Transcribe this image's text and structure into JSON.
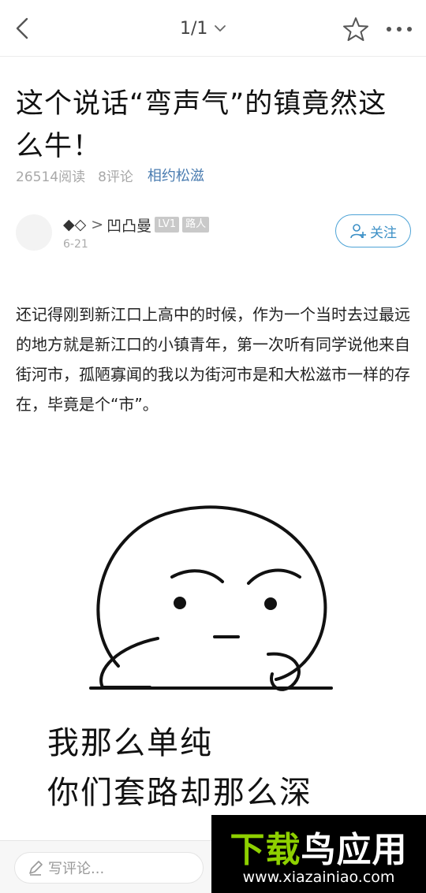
{
  "header": {
    "pager": "1/1"
  },
  "article": {
    "title": "这个说话“弯声气”的镇竟然这么牛！",
    "reads": "26514阅读",
    "comments": "8评论",
    "tag": "相约松滋",
    "body": "还记得刚到新江口上高中的时候，作为一个当时去过最远的地方就是新江口的小镇青年，第一次听有同学说他来自街河市，孤陋寡闻的我以为街河市是和大松滋市一样的存在，毕竟是个“市”。"
  },
  "author": {
    "prefix": "◆◇",
    "separator": ">",
    "name": "凹凸曼",
    "level": "LV1",
    "rank": "路人",
    "date": "6-21",
    "follow_label": "关注"
  },
  "meme": {
    "line1": "我那么单纯",
    "line2": "你们套路却那么深"
  },
  "comment_bar": {
    "placeholder": "写评论..."
  },
  "watermark": {
    "brand_dark": "下载",
    "brand_green": "鸟",
    "brand_tail": "应用",
    "url": "www.xiazainiao.com"
  },
  "colors": {
    "accent": "#3b8fc6",
    "tag": "#4a7cb0",
    "watermark_green": "#8ed000"
  }
}
